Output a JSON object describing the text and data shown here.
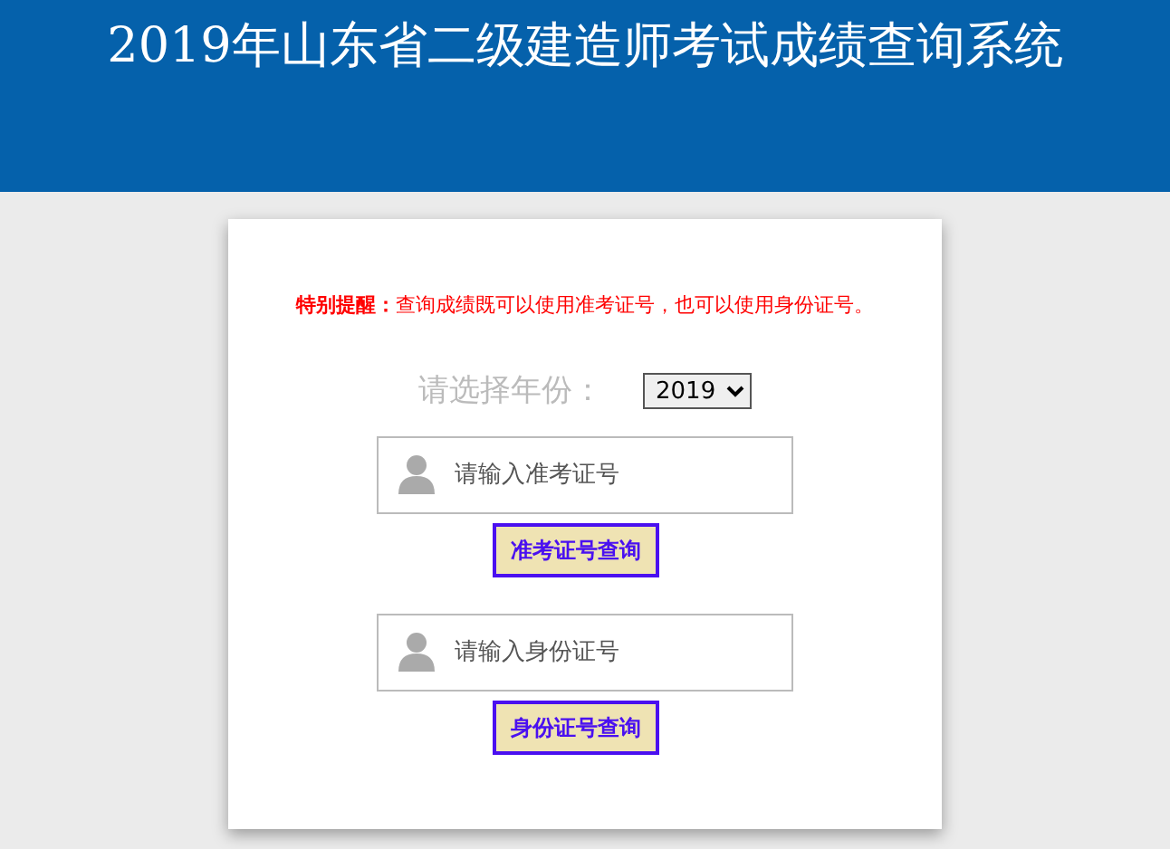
{
  "header": {
    "title": "2019年山东省二级建造师考试成绩查询系统"
  },
  "notice": "**特别提醒：**查询成绩既可以使用准考证号，也可以使用身份证号。",
  "year": {
    "label": "请选择年份：",
    "value": "2019"
  },
  "queries": [
    {
      "placeholder": "请输入准考证号",
      "button": "准考证号查询"
    },
    {
      "placeholder": "请输入身份证号",
      "button": "身份证号查询"
    }
  ]
}
